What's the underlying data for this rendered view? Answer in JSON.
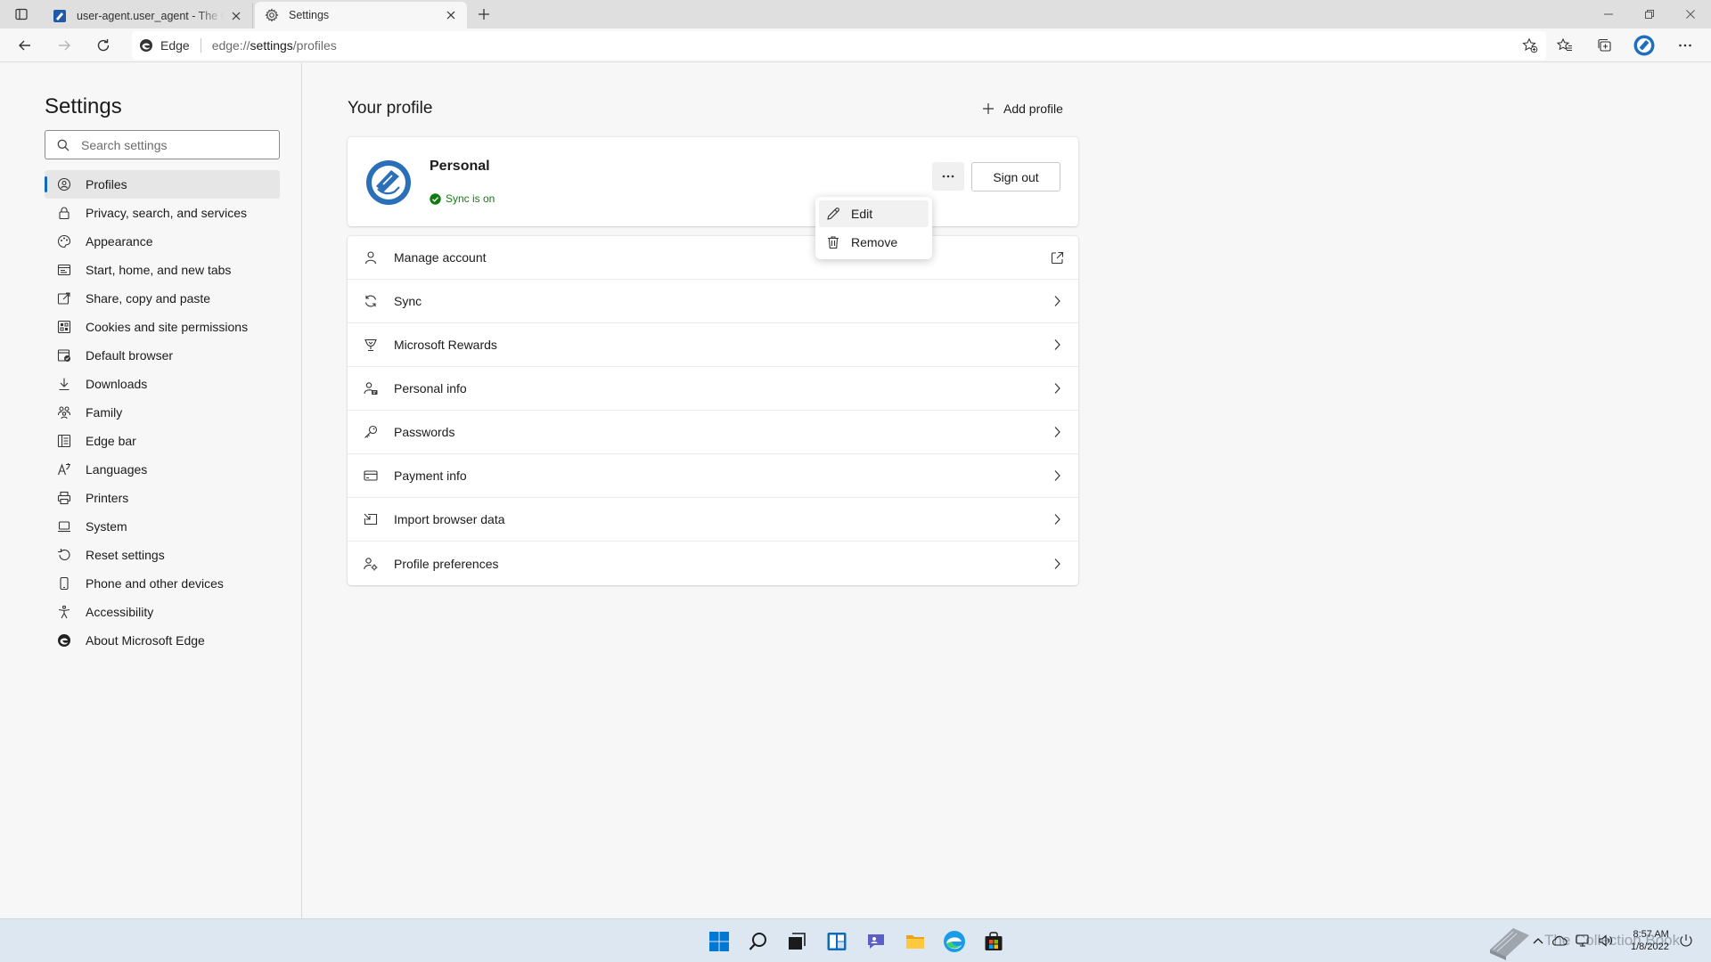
{
  "colors": {
    "accent": "#0f6cbd",
    "sync_green": "#107c10",
    "taskbar": "#dde7f1"
  },
  "browser": {
    "tabs": [
      {
        "title": "user-agent.user_agent - The Coll",
        "icon": "book-favicon-icon"
      },
      {
        "title": "Settings",
        "icon": "gear-icon"
      }
    ],
    "address": {
      "site_chip": "Edge",
      "url_prefix": "edge://",
      "url_strong": "settings",
      "url_suffix": "/profiles"
    }
  },
  "sidebar": {
    "title": "Settings",
    "search_placeholder": "Search settings",
    "items": [
      {
        "label": "Profiles",
        "icon": "profile-card-icon",
        "active": true
      },
      {
        "label": "Privacy, search, and services",
        "icon": "lock-icon"
      },
      {
        "label": "Appearance",
        "icon": "palette-icon"
      },
      {
        "label": "Start, home, and new tabs",
        "icon": "home-window-icon"
      },
      {
        "label": "Share, copy and paste",
        "icon": "share-icon"
      },
      {
        "label": "Cookies and site permissions",
        "icon": "cookies-icon"
      },
      {
        "label": "Default browser",
        "icon": "default-browser-icon"
      },
      {
        "label": "Downloads",
        "icon": "download-icon"
      },
      {
        "label": "Family",
        "icon": "family-icon"
      },
      {
        "label": "Edge bar",
        "icon": "edge-bar-icon"
      },
      {
        "label": "Languages",
        "icon": "languages-icon"
      },
      {
        "label": "Printers",
        "icon": "printer-icon"
      },
      {
        "label": "System",
        "icon": "laptop-icon"
      },
      {
        "label": "Reset settings",
        "icon": "reset-icon"
      },
      {
        "label": "Phone and other devices",
        "icon": "phone-icon"
      },
      {
        "label": "Accessibility",
        "icon": "accessibility-icon"
      },
      {
        "label": "About Microsoft Edge",
        "icon": "edge-logo-icon"
      }
    ]
  },
  "main": {
    "title": "Your profile",
    "add_profile_label": "Add profile",
    "profile": {
      "name": "Personal",
      "sync_status": "Sync is on",
      "sign_out_label": "Sign out"
    },
    "menu": [
      {
        "label": "Edit",
        "icon": "pencil-icon"
      },
      {
        "label": "Remove",
        "icon": "trash-icon"
      }
    ],
    "rows": [
      {
        "label": "Manage account",
        "icon": "person-icon",
        "action": "external-link-icon"
      },
      {
        "label": "Sync",
        "icon": "sync-icon",
        "action": "chevron-right-icon"
      },
      {
        "label": "Microsoft Rewards",
        "icon": "trophy-icon",
        "action": "chevron-right-icon"
      },
      {
        "label": "Personal info",
        "icon": "personal-info-icon",
        "action": "chevron-right-icon"
      },
      {
        "label": "Passwords",
        "icon": "key-icon",
        "action": "chevron-right-icon"
      },
      {
        "label": "Payment info",
        "icon": "credit-card-icon",
        "action": "chevron-right-icon"
      },
      {
        "label": "Import browser data",
        "icon": "import-icon",
        "action": "chevron-right-icon"
      },
      {
        "label": "Profile preferences",
        "icon": "profile-preferences-icon",
        "action": "chevron-right-icon"
      }
    ]
  },
  "taskbar": {
    "watermark_text": "The Collection Book",
    "time": "8:57 AM",
    "date": "1/8/2022"
  }
}
